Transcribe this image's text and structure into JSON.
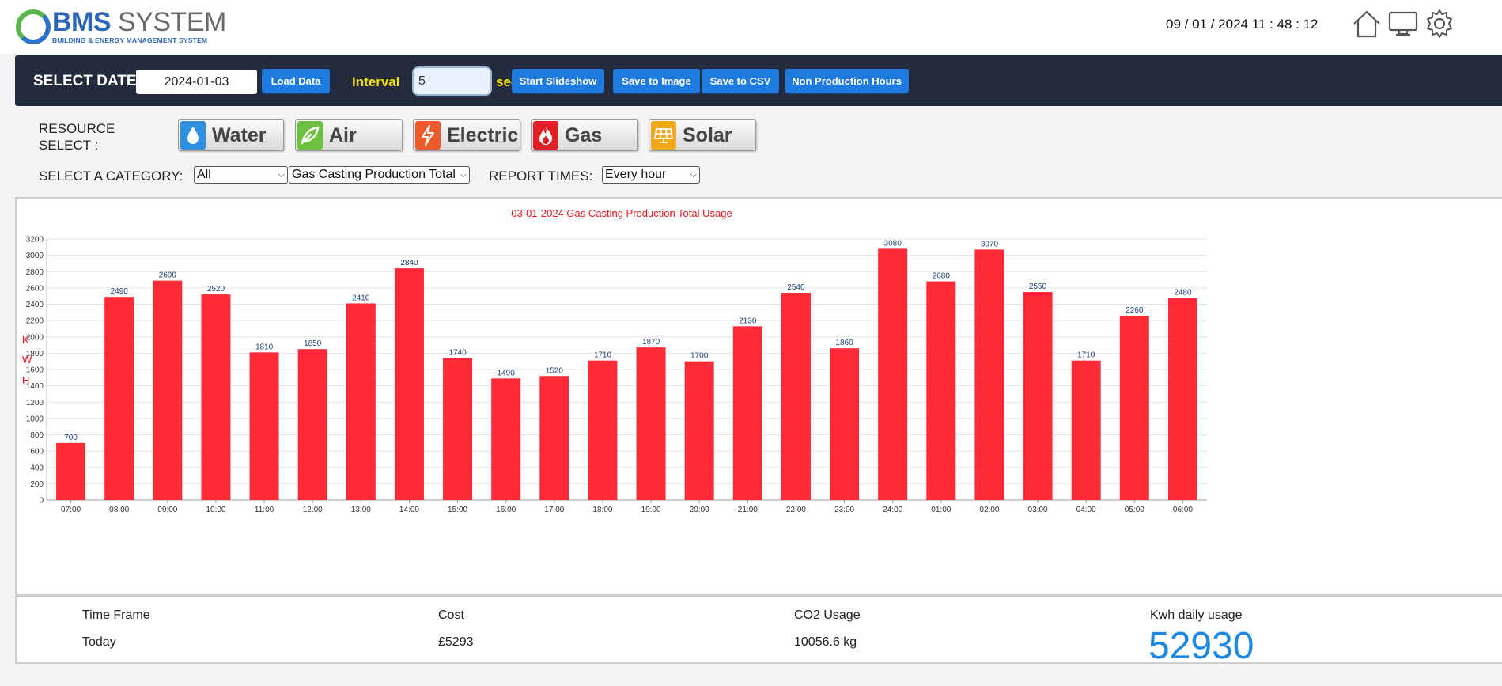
{
  "header": {
    "logo_main_1": "BMS",
    "logo_main_2": "SYSTEM",
    "logo_sub": "BUILDING & ENERGY MANAGEMENT SYSTEM",
    "clock": "09 / 01 / 2024 11 : 48 : 12",
    "icons": [
      "home-icon",
      "monitor-icon",
      "gear-icon"
    ]
  },
  "toolbar": {
    "select_date_label": "SELECT DATE:",
    "date_value": "2024-01-03",
    "load_data": "Load Data",
    "interval_label": "Interval",
    "interval_value": "5",
    "secs_label": "secs",
    "start_slideshow": "Start Slideshow",
    "save_image": "Save to Image",
    "save_csv": "Save to CSV",
    "non_production": "Non Production Hours"
  },
  "resource": {
    "label_line1": "RESOURCE",
    "label_line2": "SELECT :",
    "buttons": [
      {
        "label": "Water",
        "icon": "water-drop-icon",
        "color": "#2f8fe0"
      },
      {
        "label": "Air",
        "icon": "air-leaf-icon",
        "color": "#6cc23f"
      },
      {
        "label": "Electric",
        "icon": "lightning-icon",
        "color": "#ee5b2a"
      },
      {
        "label": "Gas",
        "icon": "flame-icon",
        "color": "#e21f26"
      },
      {
        "label": "Solar",
        "icon": "solar-panel-icon",
        "color": "#f2a81c"
      }
    ]
  },
  "filters": {
    "category_label": "SELECT A CATEGORY:",
    "category_value": "All",
    "subcategory_value": "Gas Casting Production Total",
    "report_times_label": "REPORT TIMES:",
    "report_times_value": "Every hour"
  },
  "chart_data": {
    "type": "bar",
    "title": "03-01-2024 Gas Casting Production Total Usage",
    "ylabel": "KWH",
    "ylabel_letters": [
      "K",
      "W",
      "H"
    ],
    "ylim": [
      0,
      3200
    ],
    "ytick_step": 200,
    "categories": [
      "07:00",
      "08:00",
      "09:00",
      "10:00",
      "11:00",
      "12:00",
      "13:00",
      "14:00",
      "15:00",
      "16:00",
      "17:00",
      "18:00",
      "19:00",
      "20:00",
      "21:00",
      "22:00",
      "23:00",
      "24:00",
      "01:00",
      "02:00",
      "03:00",
      "04:00",
      "05:00",
      "06:00"
    ],
    "values": [
      700,
      2490,
      2690,
      2520,
      1810,
      1850,
      2410,
      2840,
      1740,
      1490,
      1520,
      1710,
      1870,
      1700,
      2130,
      2540,
      1860,
      3080,
      2680,
      3070,
      2550,
      1710,
      2260,
      2480
    ],
    "bar_color": "#ff1f2d",
    "title_color": "#e8131f",
    "grid": true
  },
  "summary": {
    "time_frame_label": "Time Frame",
    "time_frame_value": "Today",
    "cost_label": "Cost",
    "cost_value": "£5293",
    "co2_label": "CO2 Usage",
    "co2_value": "10056.6 kg",
    "kwh_label": "Kwh daily usage",
    "kwh_value": "52930"
  }
}
